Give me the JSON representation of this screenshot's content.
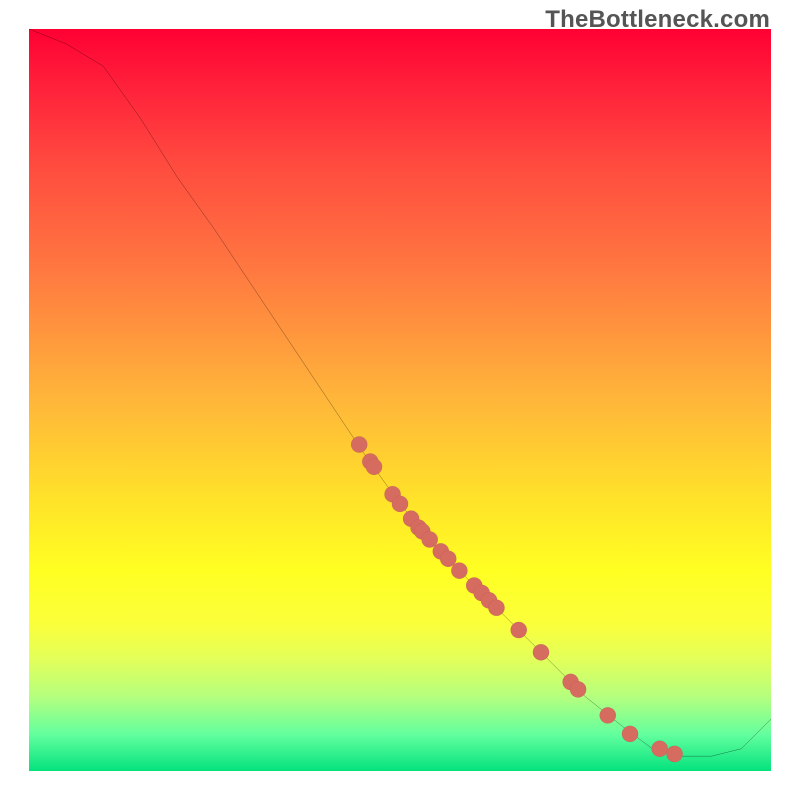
{
  "watermark": "TheBottleneck.com",
  "chart_data": {
    "type": "line",
    "title": "",
    "xlabel": "",
    "ylabel": "",
    "xlim": [
      0,
      100
    ],
    "ylim": [
      0,
      100
    ],
    "grid": false,
    "series": [
      {
        "name": "curve",
        "x": [
          0,
          5,
          10,
          15,
          20,
          25,
          30,
          35,
          40,
          45,
          50,
          55,
          60,
          65,
          70,
          75,
          80,
          84,
          88,
          92,
          96,
          100
        ],
        "y": [
          100,
          98,
          95,
          88,
          80,
          73,
          65.5,
          58,
          50.5,
          43,
          36,
          30,
          25,
          20,
          15,
          10,
          6,
          3,
          2,
          2,
          3,
          7
        ]
      }
    ],
    "scatter": {
      "name": "points",
      "x": [
        44.5,
        46,
        46.5,
        49,
        50,
        51.5,
        52.5,
        53,
        54,
        55.5,
        56.5,
        58,
        60,
        61,
        62,
        63,
        66,
        69,
        73,
        74,
        78,
        81,
        85,
        87
      ],
      "y": [
        44.0,
        41.7,
        41.0,
        37.3,
        36.0,
        34.0,
        32.8,
        32.3,
        31.2,
        29.6,
        28.6,
        27.0,
        25.0,
        24.0,
        23.0,
        22.0,
        19.0,
        16.0,
        12.0,
        11.0,
        7.5,
        5.0,
        3.0,
        2.3
      ]
    },
    "background_gradient": {
      "top": "#ff0033",
      "bottom": "#04e27e"
    }
  }
}
